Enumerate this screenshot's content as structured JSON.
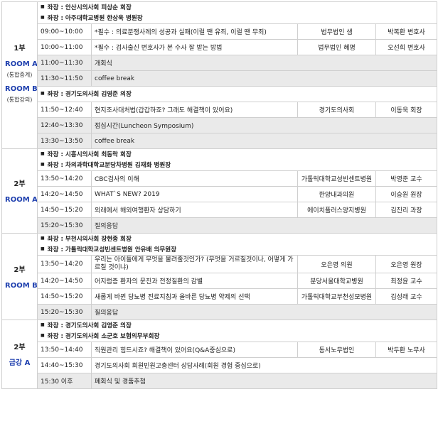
{
  "sessions": [
    {
      "part": "1부",
      "rooms": [
        "ROOM A",
        "ROOM B"
      ],
      "notes": [
        "(통합중계)",
        "(통합강의)"
      ],
      "chairs_1": [
        "좌장 : 안산시의사회 피상순 회장",
        "좌장 : 아주대학교병원 한상욱 병원장"
      ],
      "rows_1": [
        {
          "time": "09:00~10:00",
          "title": "*필수 : 의료분쟁사례의 성공과 실패(이럴 땐 유죄, 이럴 땐 무죄)",
          "org": "법무법인 샘",
          "speaker": "박복환 변호사",
          "shade": false
        },
        {
          "time": "10:00~11:00",
          "title": "*필수 : 검사출신 변호사가 본 수사 잘 받는 방법",
          "org": "법무법인 혜명",
          "speaker": "오선희 변호사",
          "shade": false
        },
        {
          "time": "11:00~11:30",
          "title": "개회식",
          "org": "",
          "speaker": "",
          "shade": true
        },
        {
          "time": "11:30~11:50",
          "title": "coffee break",
          "org": "",
          "speaker": "",
          "shade": true
        }
      ],
      "chairs_2": [
        "좌장 : 경기도의사회 김영준 의장"
      ],
      "rows_2": [
        {
          "time": "11:50~12:40",
          "title": "현지조사대처법(갑갑하죠? 그래도 해결책이 있어요)",
          "org": "경기도의사회",
          "speaker": "이동욱 회장",
          "shade": false
        },
        {
          "time": "12:40~13:30",
          "title": "점심시간(Luncheon Symposium)",
          "org": "",
          "speaker": "",
          "shade": true
        },
        {
          "time": "13:30~13:50",
          "title": "coffee break",
          "org": "",
          "speaker": "",
          "shade": true
        }
      ]
    },
    {
      "part": "2부",
      "rooms": [
        "ROOM A"
      ],
      "chairs": [
        "좌장 : 시흥시의사회 최동락 회장",
        "좌장 : 차의과학대학교분당차병원 김재화 병원장"
      ],
      "rows": [
        {
          "time": "13:50~14:20",
          "title": "CBC검사의 이해",
          "org": "가톨릭대학교성빈센트병원",
          "speaker": "박영준 교수",
          "shade": false
        },
        {
          "time": "14:20~14:50",
          "title": "WHAT`S NEW? 2019",
          "org": "한양내과의원",
          "speaker": "이승원 원장",
          "shade": false
        },
        {
          "time": "14:50~15:20",
          "title": "외래에서 해외여행환자 상담하기",
          "org": "에이치플러스양지병원",
          "speaker": "김진리 과장",
          "shade": false
        },
        {
          "time": "15:20~15:30",
          "title": "질의응답",
          "org": "",
          "speaker": "",
          "shade": true
        }
      ]
    },
    {
      "part": "2부",
      "rooms": [
        "ROOM B"
      ],
      "chairs": [
        "좌장 : 부천시의사회 장현종 회장",
        "좌장 : 가톨릭대학교성빈센트병원 안유배 의무원장"
      ],
      "rows": [
        {
          "time": "13:50~14:20",
          "title": "우리는 아이들에게 무엇을 물려줄것인가? (무엇을 거르칠것이나, 어떻게 가르칠 것이냐)",
          "org": "오은영 의원",
          "speaker": "오은영 원장",
          "shade": false,
          "tall": true
        },
        {
          "time": "14:20~14:50",
          "title": "어지럼증 환자의 문진과 전정질환의 감별",
          "org": "분당서울대학교병원",
          "speaker": "최정윤 교수",
          "shade": false
        },
        {
          "time": "14:50~15:20",
          "title": "새롭게 바뀐 당뇨병 진료지침과 올바른 당뇨병 약제의 선택",
          "org": "가톨릭대학교부천성모병원",
          "speaker": "김성래 교수",
          "shade": false
        },
        {
          "time": "15:20~15:30",
          "title": "질의응답",
          "org": "",
          "speaker": "",
          "shade": true
        }
      ]
    },
    {
      "part": "2부",
      "rooms": [
        "금강 A"
      ],
      "chairs": [
        "좌장 : 경기도의사회 김영준 의장",
        "좌장 : 경기도의사회 소군호 보험의무부회장"
      ],
      "rows": [
        {
          "time": "13:50~14:40",
          "title": "직원관리 힘드시죠? 해결책이 있어요(Q&A중심으로)",
          "org": "동서노무법인",
          "speaker": "박두환 노무사",
          "shade": false
        },
        {
          "time": "14:40~15:30",
          "title": "경기도의사회 회원민원고충센터 상담사례(회원 경험 중심으로)",
          "org": "",
          "speaker": "",
          "shade": false
        },
        {
          "time": "15:30 이후",
          "title": "폐회식 및 경품추첨",
          "org": "",
          "speaker": "",
          "shade": true
        }
      ]
    }
  ]
}
